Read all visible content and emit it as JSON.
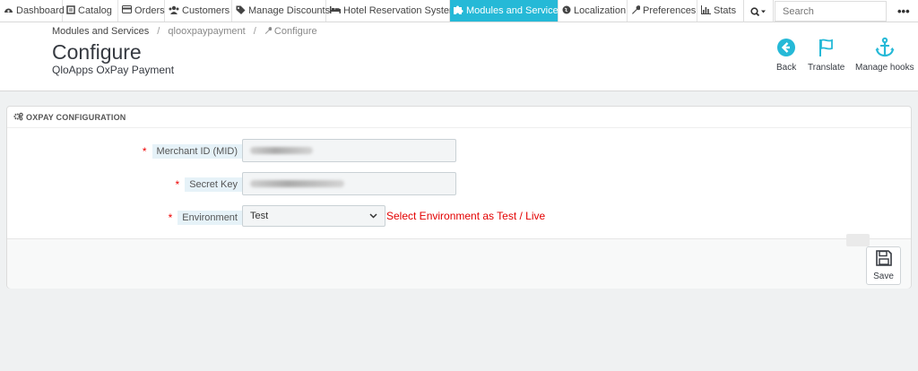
{
  "nav": {
    "items": [
      {
        "label": "Dashboard",
        "icon": "dashboard-icon",
        "glyph": "◔"
      },
      {
        "label": "Catalog",
        "icon": "catalog-icon",
        "glyph": "▤"
      },
      {
        "label": "Orders",
        "icon": "orders-icon",
        "glyph": "▭"
      },
      {
        "label": "Customers",
        "icon": "customers-icon",
        "glyph": "⚉"
      },
      {
        "label": "Manage Discounts",
        "icon": "tag-icon",
        "glyph": "◆"
      },
      {
        "label": "Hotel Reservation System",
        "icon": "bed-icon",
        "glyph": "▬"
      },
      {
        "label": "Modules and Services",
        "icon": "puzzle-icon",
        "glyph": "✚",
        "active": true
      },
      {
        "label": "Localization",
        "icon": "globe-icon",
        "glyph": "●"
      },
      {
        "label": "Preferences",
        "icon": "wrench-icon",
        "glyph": "⚒"
      },
      {
        "label": "Stats",
        "icon": "bar-chart-icon",
        "glyph": "▐"
      }
    ],
    "search_placeholder": "Search",
    "search_icon": "⌕▾",
    "more": "•••"
  },
  "breadcrumb": {
    "root": "Modules and Services",
    "module": "qlooxpaypayment",
    "current": "Configure"
  },
  "header": {
    "title": "Configure",
    "subtitle": "QloApps OxPay Payment",
    "toolbar": {
      "back": "Back",
      "translate": "Translate",
      "manage_hooks": "Manage hooks"
    }
  },
  "panel": {
    "heading": "OXPAY CONFIGURATION",
    "fields": {
      "merchant_id": {
        "label": "Merchant ID (MID)",
        "required": "*"
      },
      "secret_key": {
        "label": "Secret Key",
        "required": "*"
      },
      "environment": {
        "label": "Environment",
        "required": "*",
        "value": "Test",
        "help": "Select Environment as Test / Live"
      }
    },
    "save_label": "Save"
  },
  "colors": {
    "accent": "#25b9d7",
    "required": "#e00000",
    "help_text": "#e30000",
    "toolbar_icon": "#25b9d7"
  }
}
